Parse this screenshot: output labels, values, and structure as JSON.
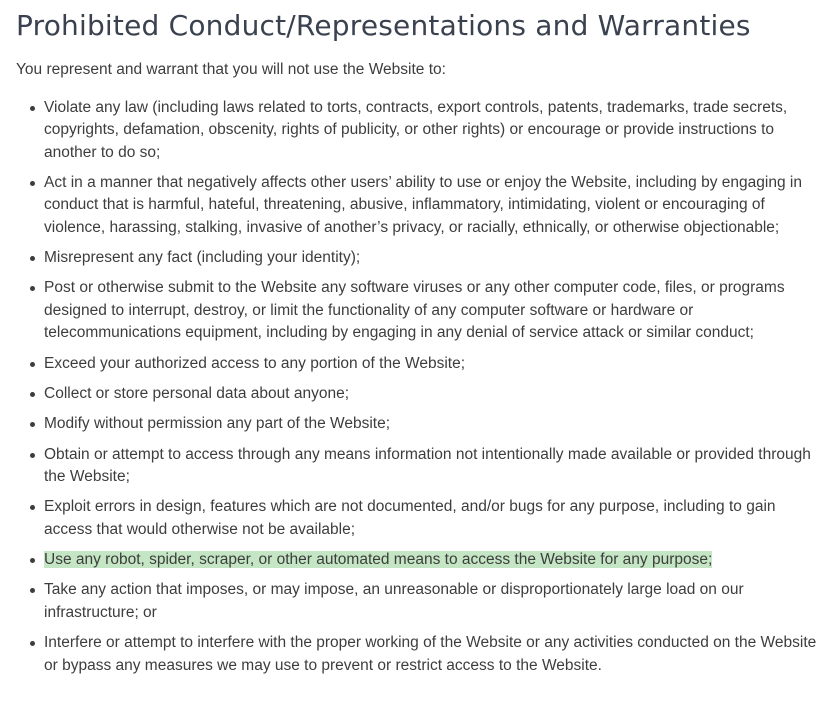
{
  "document": {
    "title": "Prohibited Conduct/Representations and Warranties",
    "intro": "You represent and warrant that you will not use the Website to:",
    "items": [
      "Violate any law (including laws related to torts, contracts, export controls, patents, trademarks, trade secrets, copyrights, defamation, obscenity, rights of publicity, or other rights) or encourage or provide instructions to another to do so;",
      "Act in a manner that negatively affects other users’ ability to use or enjoy the Website, including by engaging in conduct that is harmful, hateful, threatening, abusive, inflammatory, intimidating, violent or encouraging of violence, harassing, stalking, invasive of another’s privacy, or racially, ethnically, or otherwise objectionable;",
      "Misrepresent any fact (including your identity);",
      "Post or otherwise submit to the Website any software viruses or any other computer code, files, or programs designed to interrupt, destroy, or limit the functionality of any computer software or hardware or telecommunications equipment, including by engaging in any denial of service attack or similar conduct;",
      "Exceed your authorized access to any portion of the Website;",
      "Collect or store personal data about anyone;",
      "Modify without permission any part of the Website;",
      "Obtain or attempt to access through any means information not intentionally made available or provided through the Website;",
      "Exploit errors in design, features which are not documented, and/or bugs for any purpose, including to gain access that would otherwise not be available;",
      "Use any robot, spider, scraper, or other automated means to access the Website for any purpose;",
      "Take any action that imposes, or may impose, an unreasonable or disproportionately large load on our infrastructure; or",
      "Interfere or attempt to interfere with the proper working of the Website or any activities conducted on the Website or bypass any measures we may use to prevent or restrict access to the Website."
    ],
    "highlight_color": "#c5e6c5"
  }
}
